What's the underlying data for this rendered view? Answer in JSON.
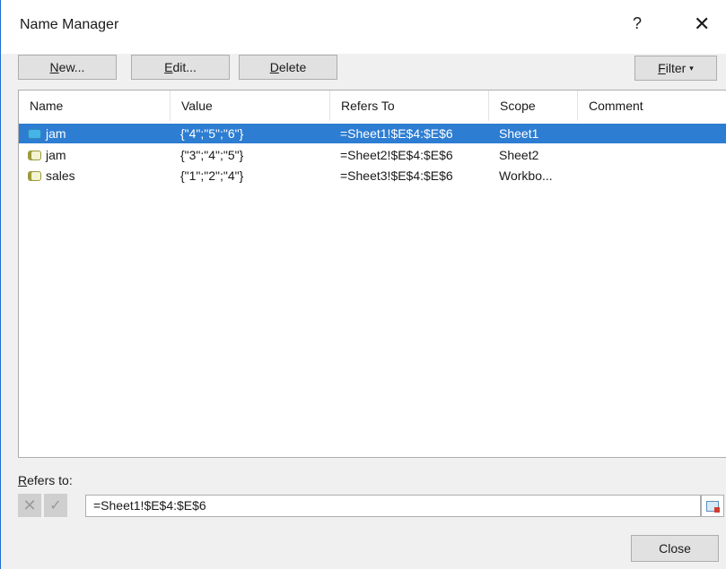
{
  "window": {
    "title": "Name Manager",
    "help_glyph": "?",
    "close_glyph": "✕"
  },
  "toolbar": {
    "new": {
      "accel": "N",
      "rest": "ew..."
    },
    "edit": {
      "accel": "E",
      "rest": "dit..."
    },
    "delete": {
      "accel": "D",
      "rest": "elete"
    },
    "filter": {
      "accel": "F",
      "rest": "ilter",
      "caret": "▾"
    }
  },
  "table": {
    "headers": [
      "Name",
      "Value",
      "Refers To",
      "Scope",
      "Comment"
    ],
    "rows": [
      {
        "name": "jam",
        "value": "{\"4\";\"5\";\"6\"}",
        "refers_to": "=Sheet1!$E$4:$E$6",
        "scope": "Sheet1",
        "comment": "",
        "selected": true
      },
      {
        "name": "jam",
        "value": "{\"3\";\"4\";\"5\"}",
        "refers_to": "=Sheet2!$E$4:$E$6",
        "scope": "Sheet2",
        "comment": ""
      },
      {
        "name": "sales",
        "value": "{\"1\";\"2\";\"4\"}",
        "refers_to": "=Sheet3!$E$4:$E$6",
        "scope": "Workbo...",
        "comment": ""
      }
    ]
  },
  "refers_to": {
    "label_accel": "R",
    "label_rest": "efers to:",
    "value": "=Sheet1!$E$4:$E$6",
    "cancel_glyph": "✕",
    "confirm_glyph": "✓"
  },
  "footer": {
    "close_label": "Close"
  },
  "colors": {
    "selection": "#2d7dd2",
    "window_border": "#1f6fd1",
    "dialog_bg": "#f0f0f0"
  }
}
